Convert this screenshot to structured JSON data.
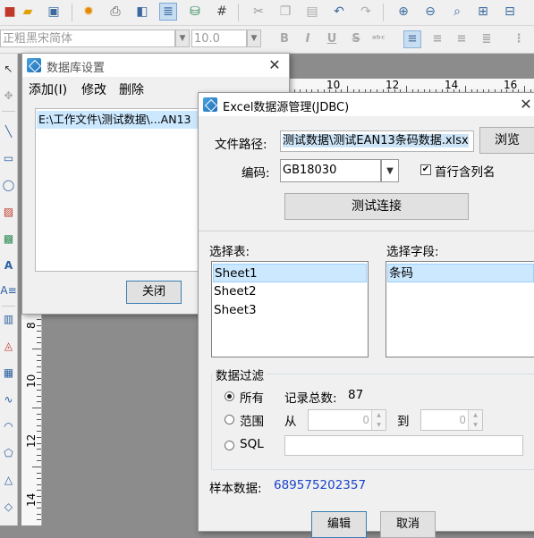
{
  "toolbar": {
    "icons": [
      "open-folder-icon",
      "save-icon",
      "gear-icon",
      "printer-icon",
      "print-preview-icon",
      "database-icon",
      "database-settings-icon",
      "grid-icon",
      "cut-icon",
      "copy-icon",
      "paste-icon",
      "undo-icon",
      "redo-icon",
      "zoom-in-icon",
      "zoom-out-icon",
      "zoom-icon",
      "fit-page-icon",
      "fit-width-icon"
    ]
  },
  "format_bar": {
    "font_name": "正粗黑宋简体",
    "font_size": "10.0",
    "bold": "B",
    "italic": "I",
    "underline": "U",
    "strike": "S",
    "abc": "ᵃᵇᶜ"
  },
  "ruler": {
    "horizontal": [
      "10",
      "12",
      "14",
      "16"
    ],
    "vertical": [
      "8",
      "10",
      "12",
      "14"
    ]
  },
  "db_dialog": {
    "title": "数据库设置",
    "menu": {
      "add": "添加(I)",
      "modify": "修改",
      "delete": "删除"
    },
    "entry": "E:\\工作文件\\测试数据\\...AN13",
    "close_button": "关闭"
  },
  "excel_dialog": {
    "title": "Excel数据源管理(JDBC)",
    "file_path_label": "文件路径:",
    "file_path_value": "测试数据\\测试EAN13条码数据.xlsx",
    "browse_button": "浏览",
    "encoding_label": "编码:",
    "encoding_value": "GB18030",
    "first_row_label": "首行含列名",
    "first_row_checked": "✔",
    "test_button": "测试连接",
    "select_table_label": "选择表:",
    "tables": [
      "Sheet1",
      "Sheet2",
      "Sheet3"
    ],
    "select_field_label": "选择字段:",
    "fields": [
      "条码"
    ],
    "filter": {
      "group_label": "数据过滤",
      "all_label": "所有",
      "total_label": "记录总数:",
      "total_value": "87",
      "range_label": "范围",
      "from_label": "从",
      "from_value": "0",
      "to_label": "到",
      "to_value": "0",
      "sql_label": "SQL",
      "sql_value": ""
    },
    "sample_label": "样本数据:",
    "sample_value": "689575202357",
    "edit_button": "编辑",
    "cancel_button": "取消"
  },
  "colors": {
    "selection": "#cce8ff",
    "sample_text": "#1a44c7",
    "canvas": "#8c8c8c"
  }
}
